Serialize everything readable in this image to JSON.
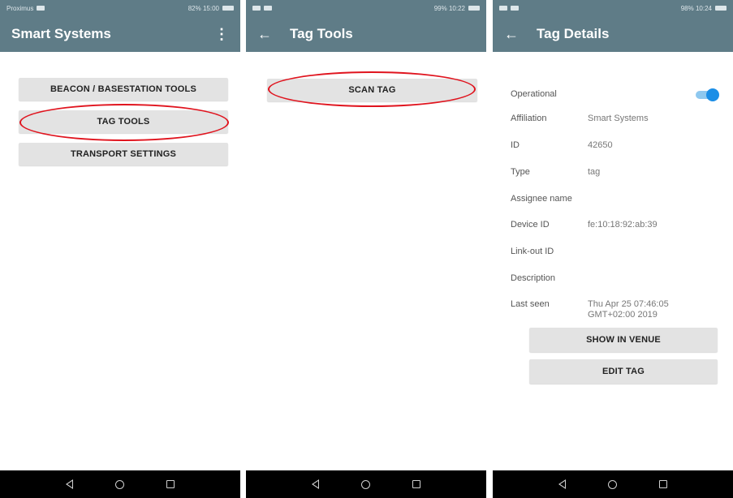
{
  "screen1": {
    "status_left": "Proximus",
    "status_right": "82% 15:00",
    "title": "Smart Systems",
    "menu_icon": "⋮",
    "buttons": [
      "BEACON / BASESTATION TOOLS",
      "TAG TOOLS",
      "TRANSPORT SETTINGS"
    ]
  },
  "screen2": {
    "status_right": "99% 10:22",
    "title": "Tag Tools",
    "back_icon": "←",
    "buttons": [
      "SCAN TAG"
    ]
  },
  "screen3": {
    "status_right": "98% 10:24",
    "title": "Tag Details",
    "back_icon": "←",
    "operational_label": "Operational",
    "operational_on": true,
    "details": [
      {
        "label": "Affiliation",
        "value": "Smart Systems"
      },
      {
        "label": "ID",
        "value": "42650"
      },
      {
        "label": "Type",
        "value": "tag"
      },
      {
        "label": "Assignee name",
        "value": ""
      },
      {
        "label": "Device ID",
        "value": "fe:10:18:92:ab:39"
      },
      {
        "label": "Link-out ID",
        "value": ""
      },
      {
        "label": "Description",
        "value": ""
      },
      {
        "label": "Last seen",
        "value": "Thu Apr 25 07:46:05 GMT+02:00 2019"
      }
    ],
    "buttons": [
      "SHOW IN VENUE",
      "EDIT TAG"
    ]
  },
  "colors": {
    "appbar": "#5f7c87",
    "highlight": "#e0141e",
    "toggle": "#1b8ee6"
  }
}
